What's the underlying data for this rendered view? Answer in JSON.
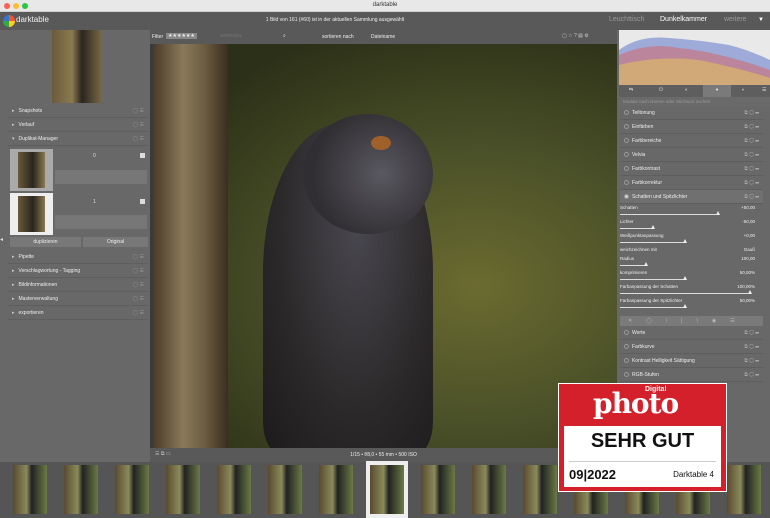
{
  "window": {
    "title": "darktable"
  },
  "header": {
    "app_name": "darktable",
    "status": "1 Bild von 161 (#60) ist in der aktuellen Sammlung ausgewählt",
    "views": [
      "Leuchttisch",
      "Dunkelkammer",
      "weitere"
    ]
  },
  "filterbar": {
    "filter_label": "Filter",
    "rating": "★★★★★★",
    "sort_label": "sortieren nach",
    "sort_value": "Dateiname"
  },
  "left_panel": {
    "modules_top": [
      "Snapshots",
      "Verlauf",
      "Duplikat-Manager"
    ],
    "duplicates": [
      {
        "version": "0"
      },
      {
        "version": "1"
      }
    ],
    "buttons": {
      "duplicate": "duplizieren",
      "original": "Original"
    },
    "modules_bottom": [
      "Pipette",
      "Verschlagwortung - Tagging",
      "Bildinformationen",
      "Masterverwaltung",
      "exportieren"
    ]
  },
  "right_panel": {
    "search_placeholder": "Module nach Namen oder Stichwort suchen",
    "modules": [
      "Teiltonung",
      "Einfärben",
      "Farbbereiche",
      "Velvia",
      "Farbkontrast",
      "Farbkorrektur",
      "Schatten und Spitzlichter"
    ],
    "sliders": [
      {
        "label": "Schatten",
        "value": "+50,00",
        "level": 0.75
      },
      {
        "label": "Lichter",
        "value": "-50,00",
        "level": 0.25
      },
      {
        "label": "Weißpunktanpassung",
        "value": "+0,00",
        "level": 0.5
      },
      {
        "label": "weichzeichnen mit",
        "value": "Gauß"
      },
      {
        "label": "Radius",
        "value": "100,00",
        "level": 0.2
      },
      {
        "label": "komprimieren",
        "value": "50,00%",
        "level": 0.5
      },
      {
        "label": "Farbanpassung der Schatten",
        "value": "100,00%",
        "level": 1.0
      },
      {
        "label": "Farbanpassung der Spitzlichter",
        "value": "50,00%",
        "level": 0.5
      }
    ],
    "modules2": [
      "Werte",
      "Farbkurve",
      "Kontrast Helligkeit Sättigung",
      "RGB-Stufen"
    ]
  },
  "info": {
    "exif": "1/15 • f/8,0 • 55 mm • 500 ISO"
  },
  "badge": {
    "brand_top": "Digital",
    "brand": "photo",
    "rating": "SEHR GUT",
    "issue": "09|2022",
    "product": "Darktable 4",
    "color": "#d4202a"
  }
}
